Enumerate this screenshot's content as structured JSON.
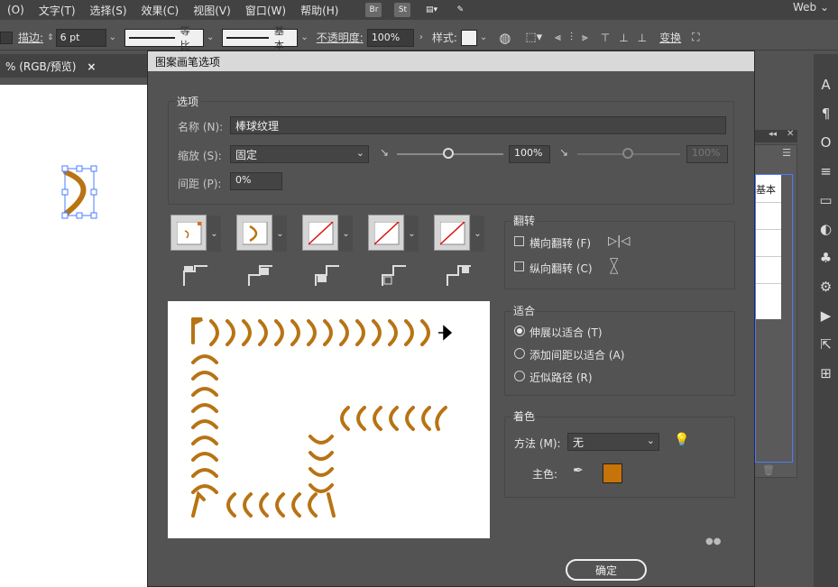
{
  "menubar": {
    "items": [
      "(O)",
      "文字(T)",
      "选择(S)",
      "效果(C)",
      "视图(V)",
      "窗口(W)",
      "帮助(H)"
    ],
    "icons": [
      {
        "label": "Br",
        "name": "bridge-icon"
      },
      {
        "label": "St",
        "name": "stock-icon"
      },
      {
        "label": "",
        "name": "arrange-documents-icon"
      },
      {
        "label": "",
        "name": "gpu-performance-icon"
      }
    ],
    "workspace": "Web"
  },
  "controlbar": {
    "stroke_label": "描边:",
    "stroke_value": "6 pt",
    "profile_1": "等比",
    "profile_2": "基本",
    "opacity_label": "不透明度:",
    "opacity_value": "100%",
    "style_label": "样式:",
    "transform_label": "变换"
  },
  "document_tab": {
    "title": "% (RGB/预览)",
    "close": "×"
  },
  "right_panel": {
    "partial_label": "基本"
  },
  "dialog": {
    "title": "图案画笔选项",
    "options_group": "选项",
    "name_label": "名称 (N):",
    "name_value": "棒球纹理",
    "scale_label": "缩放 (S):",
    "scale_value": "固定",
    "scale_min": "100%",
    "scale_max": "100%",
    "spacing_label": "间距 (P):",
    "spacing_value": "0%",
    "flip_group": "翻转",
    "flip_h": "横向翻转 (F)",
    "flip_v": "纵向翻转 (C)",
    "fit_group": "适合",
    "fit_options": [
      "伸展以适合 (T)",
      "添加间距以适合 (A)",
      "近似路径 (R)"
    ],
    "colorize_group": "着色",
    "method_label": "方法 (M):",
    "method_value": "无",
    "key_color_label": "主色:",
    "key_color": "#c8730a",
    "ok_label": "确定"
  },
  "colors": {
    "brush": "#b87313",
    "selection": "#4a7cff"
  }
}
